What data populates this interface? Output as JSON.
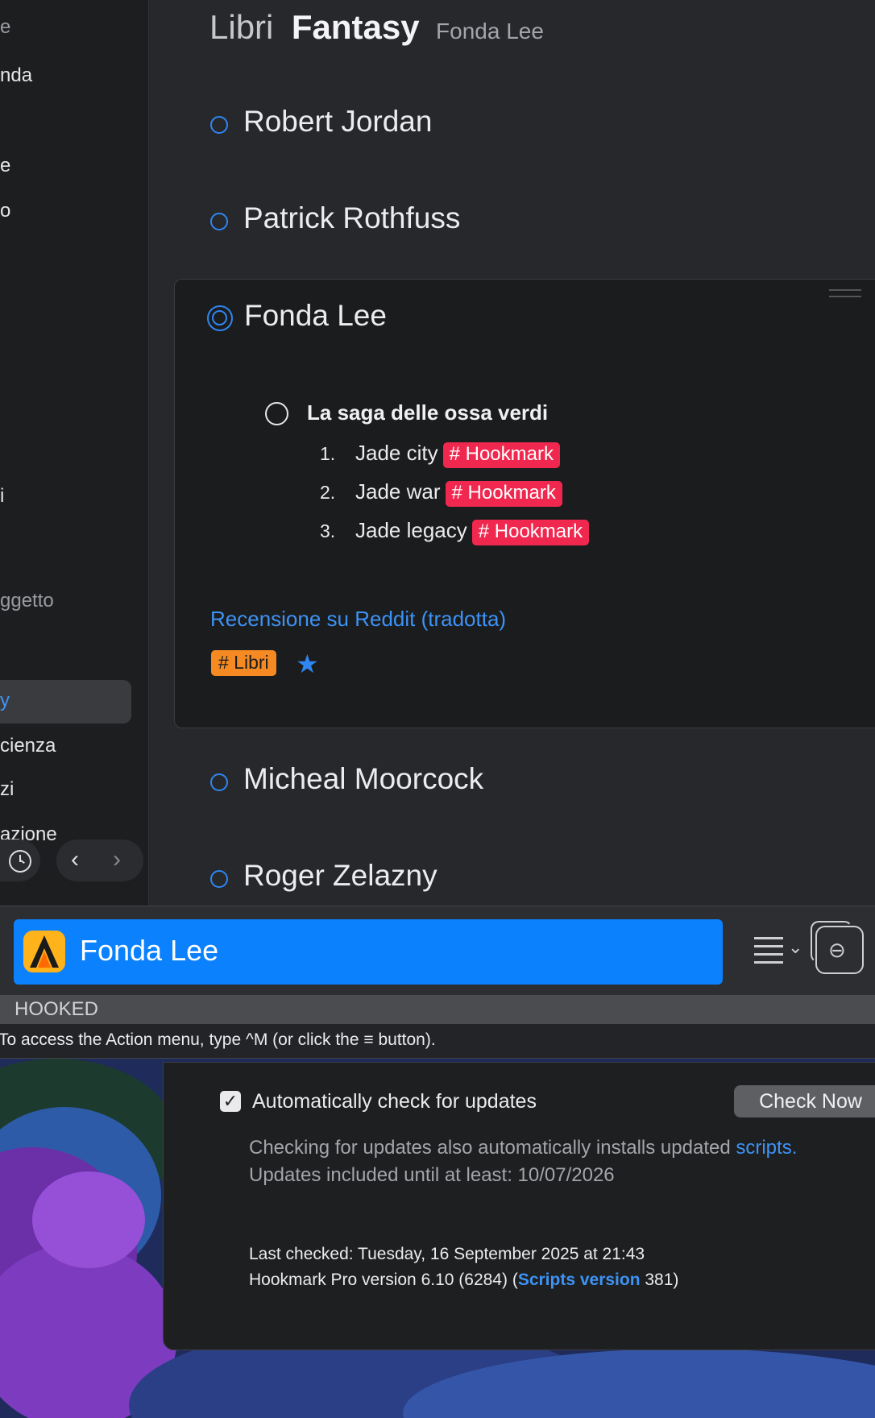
{
  "sidebar": {
    "items": [
      "e",
      "nda",
      "e",
      "o",
      "i",
      "ggetto",
      "y",
      "cienza",
      "zi",
      "azione"
    ],
    "selected_index": 6
  },
  "breadcrumb": {
    "root": "Libri",
    "current": "Fantasy",
    "sub": "Fonda Lee"
  },
  "authors_above": [
    "Robert Jordan",
    "Patrick Rothfuss"
  ],
  "card": {
    "title": "Fonda Lee",
    "todo": "La saga delle ossa verdi",
    "list": [
      {
        "num": "1.",
        "text": "Jade city",
        "tag": "# Hookmark"
      },
      {
        "num": "2.",
        "text": "Jade war",
        "tag": "# Hookmark"
      },
      {
        "num": "3.",
        "text": "Jade legacy",
        "tag": "# Hookmark"
      }
    ],
    "link": "Recensione su Reddit (tradotta)",
    "tag": "# Libri"
  },
  "authors_below": [
    "Micheal Moorcock",
    "Roger Zelazny"
  ],
  "hookmark": {
    "title": "Fonda Lee",
    "section": "HOOKED",
    "hint": "To access the Action menu, type ^M (or click the ≡ button)."
  },
  "prefs": {
    "auto_check_label": "Automatically check for updates",
    "check_now": "Check Now",
    "line1_prefix": "Checking for updates also automatically installs updated ",
    "line1_link": "scripts.",
    "line2": "Updates included until at least: 10/07/2026",
    "last_checked": "Last checked: Tuesday, 16 September 2025 at 21:43",
    "version_prefix": "Hookmark Pro version 6.10 (6284) (",
    "version_link": "Scripts version",
    "version_suffix": " 381)"
  },
  "colors": {
    "accent": "#2f86f0",
    "tag_red": "#f0284f",
    "tag_orange": "#f58a23",
    "hookmark_blue": "#0b81fd"
  }
}
